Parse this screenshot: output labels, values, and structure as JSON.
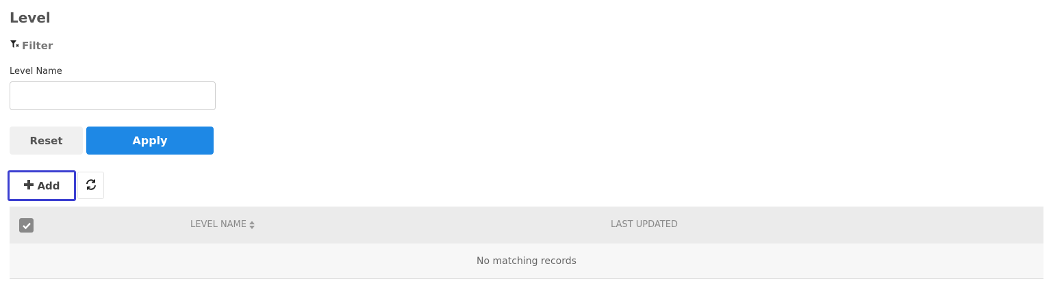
{
  "page": {
    "title": "Level"
  },
  "filter": {
    "toggle_label": "Filter",
    "fields": [
      {
        "label": "Level Name",
        "value": "",
        "placeholder": ""
      }
    ],
    "reset_label": "Reset",
    "apply_label": "Apply"
  },
  "toolbar": {
    "add_label": "Add"
  },
  "table": {
    "columns": [
      {
        "label": "LEVEL NAME",
        "sortable": true
      },
      {
        "label": "LAST UPDATED",
        "sortable": false
      }
    ],
    "empty_message": "No matching records",
    "rows": []
  },
  "colors": {
    "primary": "#1e88e5",
    "focus_outline": "#3b3fd1",
    "header_bg": "#ebebeb"
  },
  "icons": {
    "filter": "filter-icon",
    "add": "plus-icon",
    "refresh": "refresh-icon",
    "select_all": "checkbox-checked-icon",
    "sort": "sort-icon"
  }
}
